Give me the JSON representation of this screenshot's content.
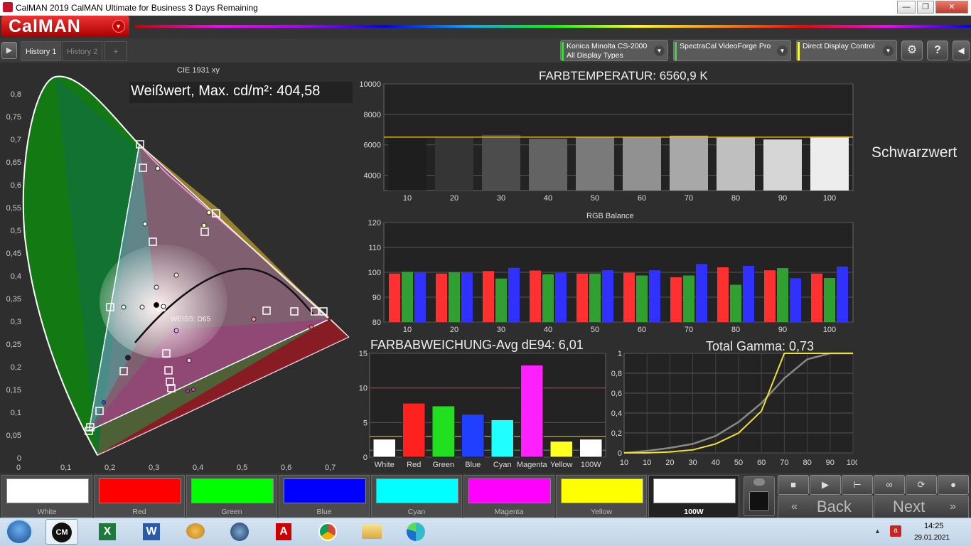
{
  "window": {
    "title": "CalMAN 2019 CalMAN Ultimate for Business 3 Days Remaining",
    "min": "—",
    "restore": "❐",
    "close": "✕"
  },
  "logo": "CalMAN",
  "tabs": [
    "History 1",
    "History 2",
    "+"
  ],
  "devices": [
    {
      "line1": "Konica Minolta CS-2000",
      "line2": "All Display Types",
      "color": "#3bdc3b"
    },
    {
      "line1": "SpectraCal VideoForge Pro",
      "line2": "",
      "color": "#3bdc3b"
    },
    {
      "line1": "Direct Display Control",
      "line2": "",
      "color": "#ffff33"
    }
  ],
  "cie": {
    "title": "CIE 1931 xy",
    "white_label": "Weißwert, Max. cd/m²: 404,58",
    "white_point_label": "WEISS: D65",
    "x_ticks": [
      "0",
      "0,1",
      "0,2",
      "0,3",
      "0,4",
      "0,5",
      "0,6",
      "0,7"
    ],
    "y_ticks": [
      "0,8",
      "0,75",
      "0,7",
      "0,65",
      "0,6",
      "0,55",
      "0,5",
      "0,45",
      "0,4",
      "0,35",
      "0,3",
      "0,25",
      "0,2",
      "0,15",
      "0,1",
      "0,05",
      "0"
    ]
  },
  "colortemp": {
    "title": "FARBTEMPERATUR: 6560,9 K",
    "y_ticks": [
      "10000",
      "8000",
      "6000",
      "4000"
    ],
    "categories": [
      "10",
      "20",
      "30",
      "40",
      "50",
      "60",
      "70",
      "80",
      "90",
      "100"
    ],
    "values": [
      6550,
      6500,
      6650,
      6400,
      6500,
      6500,
      6600,
      6500,
      6350,
      6550
    ],
    "target": 6504
  },
  "black_label": "Schwarzwert",
  "rgb": {
    "title": "RGB Balance",
    "y_ticks": [
      "120",
      "110",
      "100",
      "90",
      "80"
    ],
    "categories": [
      "10",
      "20",
      "30",
      "40",
      "50",
      "60",
      "70",
      "80",
      "90",
      "100"
    ],
    "red": [
      99.5,
      99.5,
      100.5,
      100.7,
      99.5,
      99.8,
      98,
      102,
      100.8,
      99.5
    ],
    "green": [
      100.2,
      100,
      97.5,
      99.2,
      99.5,
      98.7,
      98.7,
      95,
      101.7,
      97.7
    ],
    "blue": [
      99.8,
      99.8,
      101.8,
      99.7,
      100.8,
      100.8,
      103.3,
      102.6,
      97.6,
      102.3
    ]
  },
  "deltae": {
    "title": "FARBABWEICHUNG-Avg dE94: 6,01",
    "y_ticks": [
      "15",
      "10",
      "5",
      "0"
    ],
    "categories": [
      "White",
      "Red",
      "Green",
      "Blue",
      "Cyan",
      "Magenta",
      "Yellow",
      "100W"
    ],
    "values": [
      2.6,
      7.8,
      7.4,
      6.2,
      5.4,
      13.3,
      2.3,
      2.6
    ],
    "colors": [
      "#ffffff",
      "#ff2020",
      "#20e020",
      "#2040ff",
      "#20ffff",
      "#ff20ff",
      "#ffff20",
      "#ffffff"
    ],
    "thresholds": [
      10,
      3,
      1
    ]
  },
  "gamma": {
    "title": "Total Gamma: 0,73",
    "y_ticks": [
      "1",
      "0,8",
      "0,6",
      "0,4",
      "0,2",
      "0"
    ],
    "x_ticks": [
      "10",
      "20",
      "30",
      "40",
      "50",
      "60",
      "70",
      "80",
      "90",
      "100"
    ],
    "measured_x": [
      0,
      10,
      20,
      30,
      40,
      50,
      60,
      70,
      80,
      90,
      100
    ],
    "measured_y": [
      0,
      0.02,
      0.05,
      0.09,
      0.17,
      0.31,
      0.5,
      0.75,
      0.94,
      1,
      1
    ],
    "target_x": [
      0,
      10,
      20,
      30,
      40,
      50,
      60,
      70,
      80,
      90,
      100
    ],
    "target_y": [
      0,
      0,
      0.01,
      0.03,
      0.09,
      0.2,
      0.42,
      1,
      1,
      1,
      1
    ]
  },
  "swatches": [
    {
      "label": "White",
      "color": "#ffffff"
    },
    {
      "label": "Red",
      "color": "#ff0000"
    },
    {
      "label": "Green",
      "color": "#00ff00"
    },
    {
      "label": "Blue",
      "color": "#0000ff"
    },
    {
      "label": "Cyan",
      "color": "#00ffff"
    },
    {
      "label": "Magenta",
      "color": "#ff00ff"
    },
    {
      "label": "Yellow",
      "color": "#ffff00"
    },
    {
      "label": "100W",
      "color": "#ffffff"
    }
  ],
  "nav": {
    "back": "Back",
    "next": "Next"
  },
  "clock": {
    "time": "14:25",
    "date": "29.01.2021"
  }
}
